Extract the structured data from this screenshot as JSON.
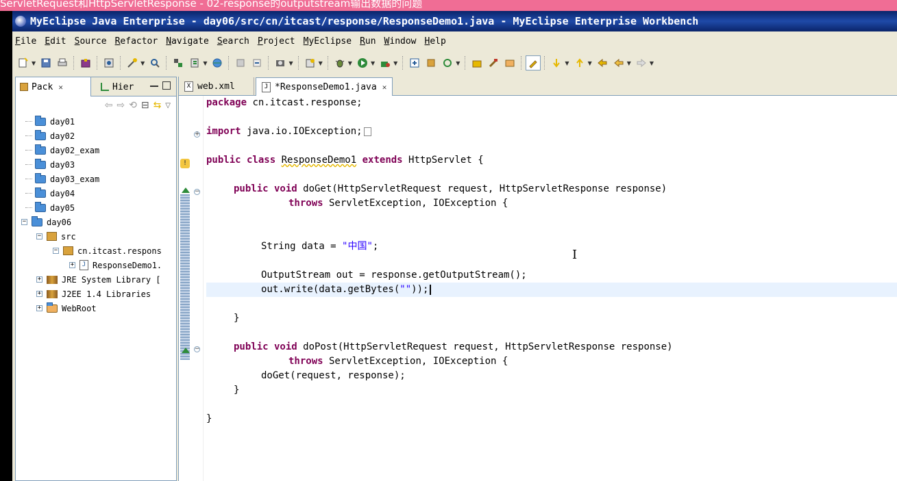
{
  "overlay": {
    "text": "ServletRequest和HttpServletResponse - 02-response的outputstream输出数据的问题"
  },
  "window": {
    "title": "MyEclipse Java Enterprise - day06/src/cn/itcast/response/ResponseDemo1.java - MyEclipse Enterprise Workbench"
  },
  "menu": [
    "File",
    "Edit",
    "Source",
    "Refactor",
    "Navigate",
    "Search",
    "Project",
    "MyEclipse",
    "Run",
    "Window",
    "Help"
  ],
  "toolbar": {
    "icons": [
      "new-icon",
      "save-icon",
      "print-icon",
      "package-icon",
      "open-type-icon",
      "new-wizard-icon",
      "search-icon",
      "deploy-icon",
      "server-icon",
      "globe-icon",
      "back-nav-icon",
      "prev-edit-icon",
      "screenshot-icon",
      "java-wizard-icon",
      "debug-icon",
      "run-icon",
      "external-tools-icon",
      "new-class-icon",
      "new-package-icon",
      "refresh-icon",
      "open-folder-icon",
      "hammer-icon",
      "folder-open-icon",
      "highlight-icon",
      "next-annotation-icon",
      "prev-annotation-icon",
      "last-edit-icon",
      "back-icon",
      "forward-icon"
    ]
  },
  "explorer": {
    "tabs": [
      {
        "label": "Pack",
        "close": "✕"
      },
      {
        "label": "Hier"
      }
    ],
    "tree": [
      {
        "label": "day01",
        "kind": "folder"
      },
      {
        "label": "day02",
        "kind": "folder"
      },
      {
        "label": "day02_exam",
        "kind": "folder"
      },
      {
        "label": "day03",
        "kind": "folder"
      },
      {
        "label": "day03_exam",
        "kind": "folder"
      },
      {
        "label": "day04",
        "kind": "folder"
      },
      {
        "label": "day05",
        "kind": "folder"
      },
      {
        "label": "day06",
        "kind": "project"
      },
      {
        "label": "src",
        "kind": "srcfolder"
      },
      {
        "label": "cn.itcast.respons",
        "kind": "package"
      },
      {
        "label": "ResponseDemo1.",
        "kind": "javafile"
      },
      {
        "label": "JRE System Library [",
        "kind": "library"
      },
      {
        "label": "J2EE 1.4 Libraries",
        "kind": "library"
      },
      {
        "label": "WebRoot",
        "kind": "folder"
      }
    ]
  },
  "editor": {
    "tabs": [
      {
        "label": "web.xml"
      },
      {
        "label": "*ResponseDemo1.java",
        "close": "✕"
      }
    ],
    "code": [
      {
        "kw": "package",
        "rest": " cn.itcast.response;"
      },
      {
        "kw": "import",
        "rest": " java.io.IOException;"
      },
      {
        "kw": "public class",
        "name": "ResponseDemo1",
        "kw2": "extends",
        "rest": " HttpServlet {"
      },
      {
        "kw": "public void",
        "rest": " doGet(HttpServletRequest request, HttpServletResponse response)"
      },
      {
        "kw": "throws",
        "rest": " ServletException, IOException {"
      },
      {
        "pre": "String data = ",
        "str": "\"中国\"",
        "post": ";"
      },
      {
        "text": "OutputStream out = response.getOutputStream();"
      },
      {
        "pre": "out.write(data.getBytes(",
        "str": "\"\"",
        "post": "));"
      },
      {
        "text": "}"
      },
      {
        "kw": "public void",
        "rest": " doPost(HttpServletRequest request, HttpServletResponse response)"
      },
      {
        "kw": "throws",
        "rest": " ServletException, IOException {"
      },
      {
        "text": "doGet(request, response);"
      },
      {
        "text": "}"
      },
      {
        "text": "}"
      }
    ]
  },
  "colors": {
    "keyword": "#7f0055",
    "string": "#2a00ff",
    "title_bar": "#0a246a",
    "current_line": "#e8f2fe"
  }
}
